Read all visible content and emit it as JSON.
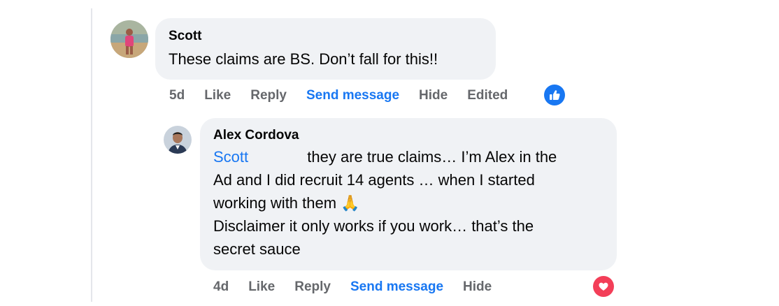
{
  "comment": {
    "author": "Scott",
    "text": "These claims are BS. Don’t fall for this!!",
    "actions": {
      "time": "5d",
      "like": "Like",
      "reply": "Reply",
      "send_message": "Send message",
      "hide": "Hide",
      "edited": "Edited"
    },
    "reaction_icon": "like-thumb-icon",
    "reaction_color": "#1877f2"
  },
  "reply": {
    "author": "Alex Cordova",
    "mention": "Scott",
    "line1": "they are true claims… I’m Alex in the",
    "line2": "Ad and I did recruit 14 agents … when I started",
    "line3": "working with them 🙏",
    "line4": "Disclaimer it only works if you work… that’s the",
    "line5": "secret sauce",
    "actions": {
      "time": "4d",
      "like": "Like",
      "reply": "Reply",
      "send_message": "Send message",
      "hide": "Hide"
    },
    "reaction_icon": "love-heart-icon",
    "reaction_color": "#f33e58"
  }
}
